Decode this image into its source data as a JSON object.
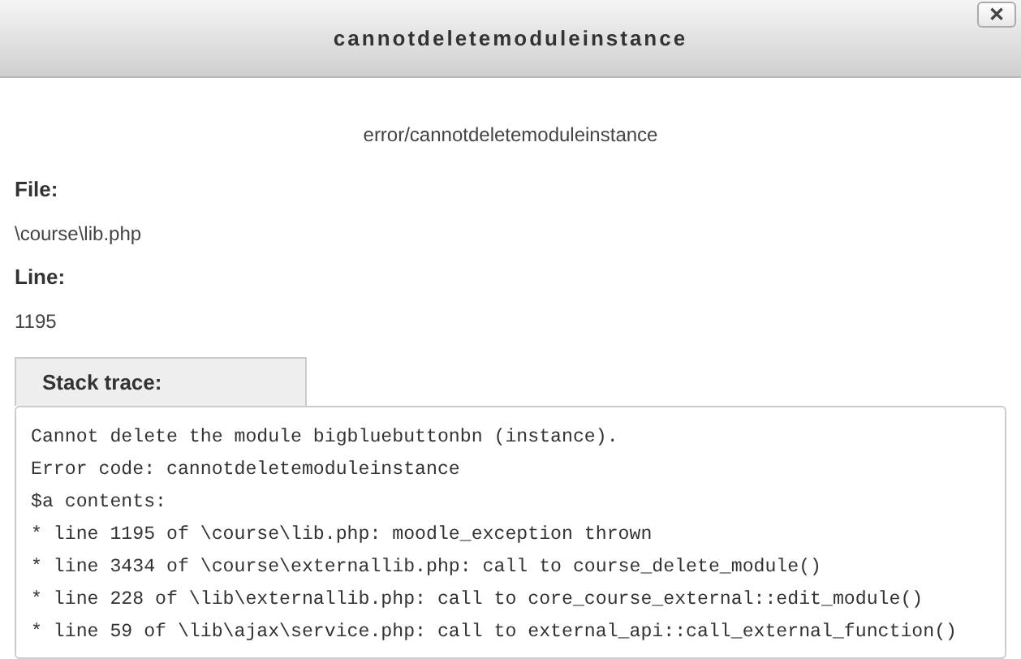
{
  "dialog": {
    "title": "cannotdeletemoduleinstance",
    "close_label": "✕"
  },
  "message": "error/cannotdeletemoduleinstance",
  "details": [
    {
      "label": "File:",
      "value": "\\course\\lib.php"
    },
    {
      "label": "Line:",
      "value": "1195"
    }
  ],
  "stack_trace": {
    "tab": "Stack trace:",
    "lines": [
      "Cannot delete the module bigbluebuttonbn (instance).",
      "Error code: cannotdeletemoduleinstance",
      "$a contents:",
      "* line 1195 of \\course\\lib.php: moodle_exception thrown",
      "* line 3434 of \\course\\externallib.php: call to course_delete_module()",
      "* line 228 of \\lib\\externallib.php: call to core_course_external::edit_module()",
      "* line 59 of \\lib\\ajax\\service.php: call to external_api::call_external_function()"
    ]
  }
}
